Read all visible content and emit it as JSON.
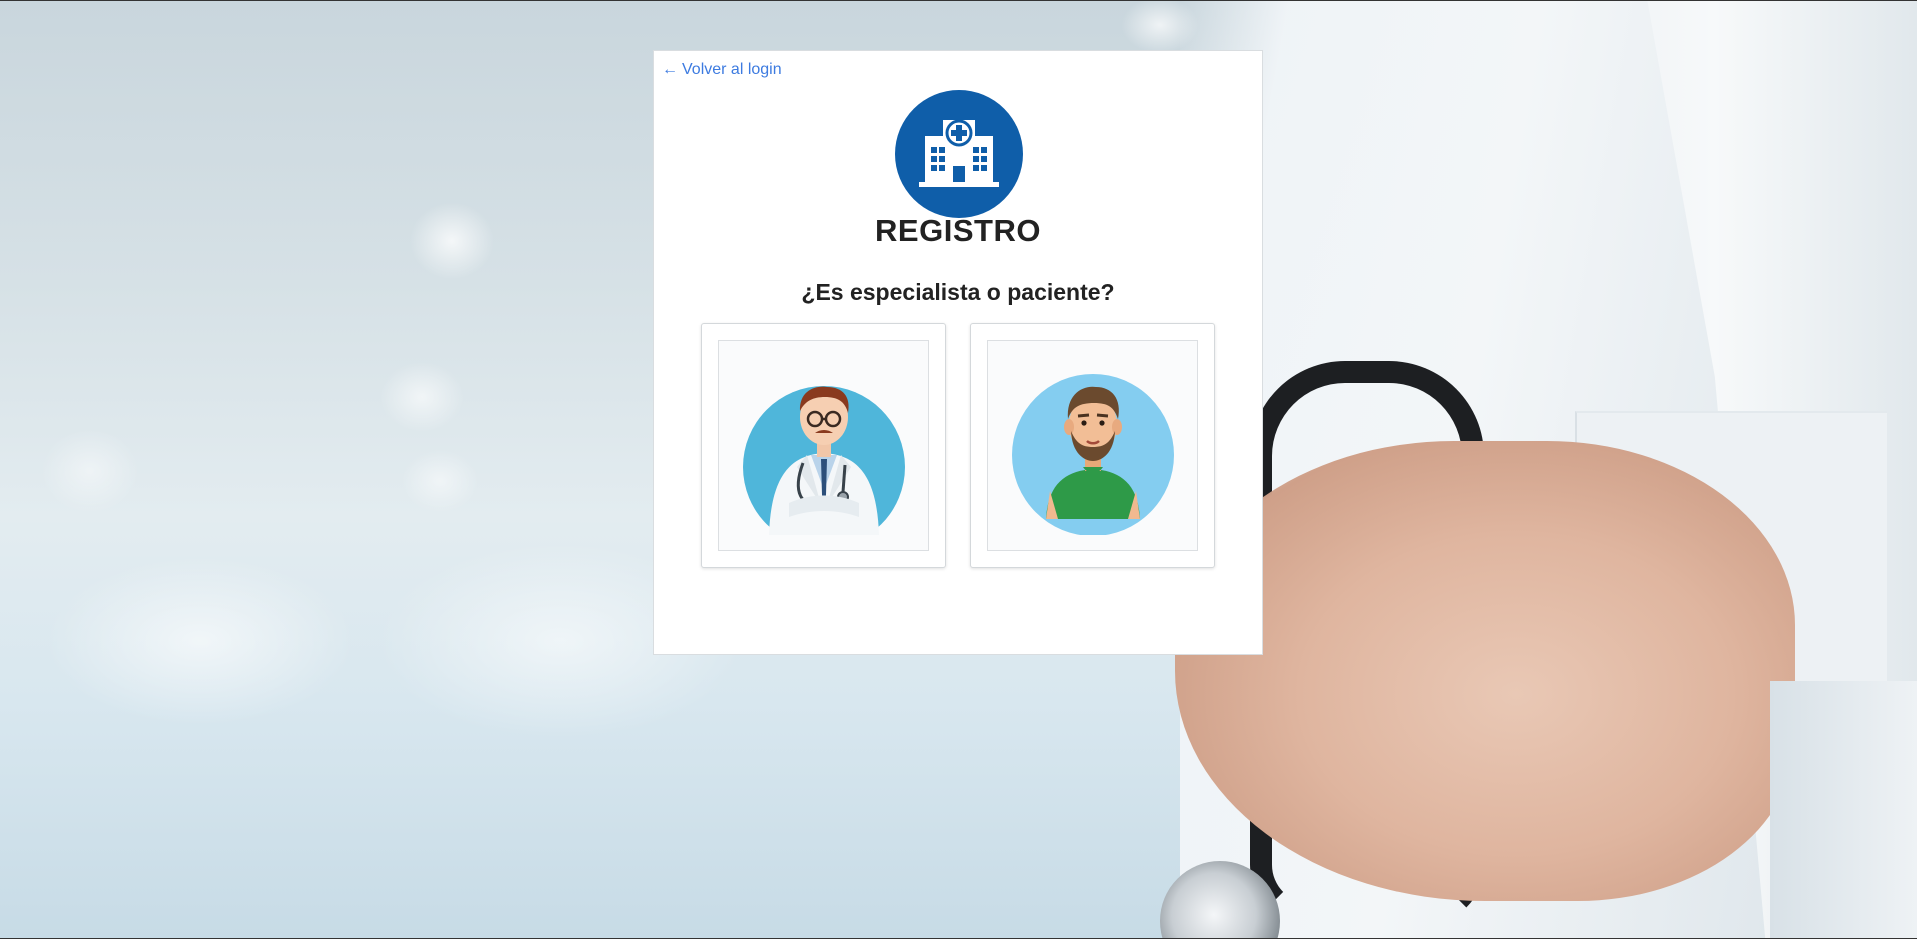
{
  "card": {
    "back_link": "Volver al login",
    "title": "REGISTRO",
    "question": "¿Es especialista o paciente?"
  },
  "options": [
    {
      "name": "especialista",
      "icon": "doctor-avatar-icon"
    },
    {
      "name": "paciente",
      "icon": "patient-avatar-icon"
    }
  ],
  "colors": {
    "link": "#3d7be0",
    "logo_bg": "#0f5ea9",
    "avatar_doctor_bg": "#4fb6da",
    "avatar_patient_bg": "#84cdf0"
  },
  "icons": {
    "logo": "hospital-icon",
    "back": "arrow-left-icon"
  }
}
